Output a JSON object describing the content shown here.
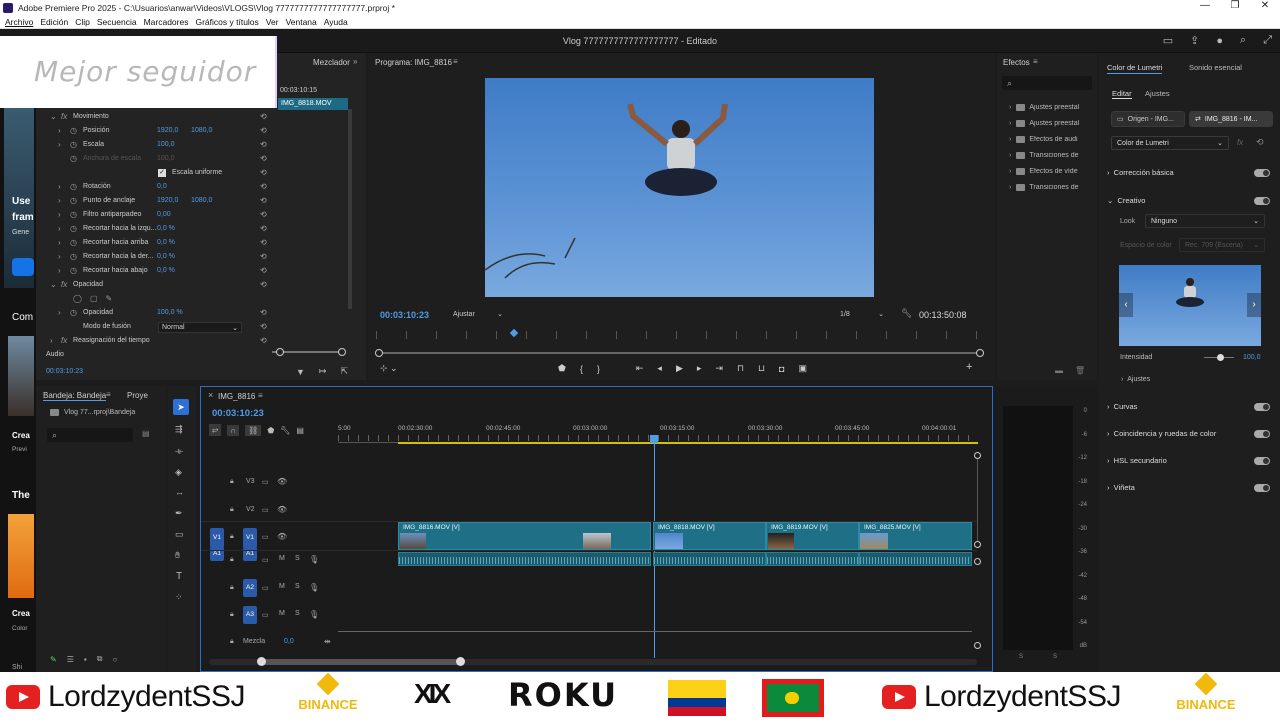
{
  "titlebar": {
    "text": "Adobe Premiere Pro 2025 - C:\\Usuarios\\anwar\\Videos\\VLOGS\\Vlog 7777777777777777777.prproj *"
  },
  "menu": [
    "Archivo",
    "Edición",
    "Clip",
    "Secuencia",
    "Marcadores",
    "Gráficos y títulos",
    "Ver",
    "Ventana",
    "Ayuda"
  ],
  "header": {
    "project_title": "Vlog 7777777777777777777 - Editado"
  },
  "overlay": {
    "text": "Mejor seguidor"
  },
  "effect_controls": {
    "tab_mezclador": "Mezclador",
    "timecode_top": "00:03:10:15",
    "clip_label": "IMG_8818.MOV",
    "rows": [
      {
        "label": "Movimiento",
        "v1": "",
        "v2": ""
      },
      {
        "label": "Posición",
        "v1": "1920,0",
        "v2": "1080,0"
      },
      {
        "label": "Escala",
        "v1": "100,0",
        "v2": ""
      },
      {
        "label": "Anchura de escala",
        "v1": "100,0",
        "v2": ""
      },
      {
        "label": "Escala uniforme",
        "v1": "",
        "v2": ""
      },
      {
        "label": "Rotación",
        "v1": "0,0",
        "v2": ""
      },
      {
        "label": "Punto de anclaje",
        "v1": "1920,0",
        "v2": "1080,0"
      },
      {
        "label": "Filtro antiparpadeo",
        "v1": "0,00",
        "v2": ""
      },
      {
        "label": "Recortar hacia la izqu...",
        "v1": "0,0 %",
        "v2": ""
      },
      {
        "label": "Recortar hacia arriba",
        "v1": "0,0 %",
        "v2": ""
      },
      {
        "label": "Recortar hacia la der...",
        "v1": "0,0 %",
        "v2": ""
      },
      {
        "label": "Recortar hacia abajo",
        "v1": "0,0 %",
        "v2": ""
      },
      {
        "label": "Opacidad",
        "v1": "",
        "v2": ""
      },
      {
        "label": "Opacidad",
        "v1": "100,0 %",
        "v2": ""
      },
      {
        "label": "Modo de fusión",
        "v1": "Normal",
        "v2": ""
      },
      {
        "label": "Reasignación del tiempo",
        "v1": "",
        "v2": ""
      },
      {
        "label": "Audio",
        "v1": "",
        "v2": ""
      }
    ],
    "timecode_bottom": "00:03:10:23"
  },
  "program": {
    "title": "Programa: IMG_8816",
    "timecode": "00:03:10:23",
    "fit": "Ajustar",
    "resolution": "1/8",
    "duration": "00:13:50:08"
  },
  "effects": {
    "title": "Efectos",
    "items": [
      "Ajustes preestal",
      "Ajustes preestal",
      "Efectos de audi",
      "Transiciones de",
      "Efectos de víde",
      "Transiciones de"
    ]
  },
  "lumetri": {
    "tab1": "Color de Lumetri",
    "tab2": "Sonido esencial",
    "edit": "Editar",
    "ajustes_tab": "Ajustes",
    "source": "Origen - IMG...",
    "target": "IMG_8816 - IM...",
    "effect": "Color de Lumetri",
    "sections": [
      "Corrección básica",
      "Creativo",
      "Curvas",
      "Coincidencia y ruedas de color",
      "HSL secundario",
      "Viñeta"
    ],
    "look_label": "Look",
    "look_value": "Ninguno",
    "space_label": "Espacio de color",
    "space_value": "Rec. 709 (Escena)",
    "intensity_label": "Intensidad",
    "intensity_value": "100,0",
    "ajustes": "Ajustes"
  },
  "left_strip": {
    "t1": "Use",
    "t2": "fram",
    "t3": "Gene",
    "t4": "Com",
    "t5": "Crea",
    "t6": "Previ",
    "t7": "The",
    "t8": "Crea",
    "t9": "Color",
    "t10": "Shi"
  },
  "bin": {
    "tab1": "Bandeja: Bandeja",
    "tab2": "Proye",
    "path": "Vlog 77...rproj\\Bandeja"
  },
  "timeline": {
    "title": "IMG_8816",
    "timecode": "00:03:10:23",
    "ruler": [
      "5:00",
      "00:02:30:00",
      "00:02:45:00",
      "00:03:00:00",
      "00:03:15:00",
      "00:03:30:00",
      "00:03:45:00",
      "00:04:00:01"
    ],
    "video_tracks": [
      "V3",
      "V2",
      "V1"
    ],
    "audio_tracks": [
      "A1",
      "A2",
      "A3"
    ],
    "mix_label": "Mezcla",
    "mix_value": "0,0",
    "clips": [
      "IMG_8816.MOV [V]",
      "IMG_8818.MOV [V]",
      "IMG_8819.MOV [V]",
      "IMG_8825.MOV [V]"
    ]
  },
  "meter": {
    "ticks": [
      "0",
      "-6",
      "-12",
      "-18",
      "-24",
      "-30",
      "-36",
      "-42",
      "-48",
      "-54",
      "dB"
    ],
    "s": "S"
  },
  "ads": {
    "channel": "LordzydentSSJ",
    "binance": "BINANCE"
  }
}
